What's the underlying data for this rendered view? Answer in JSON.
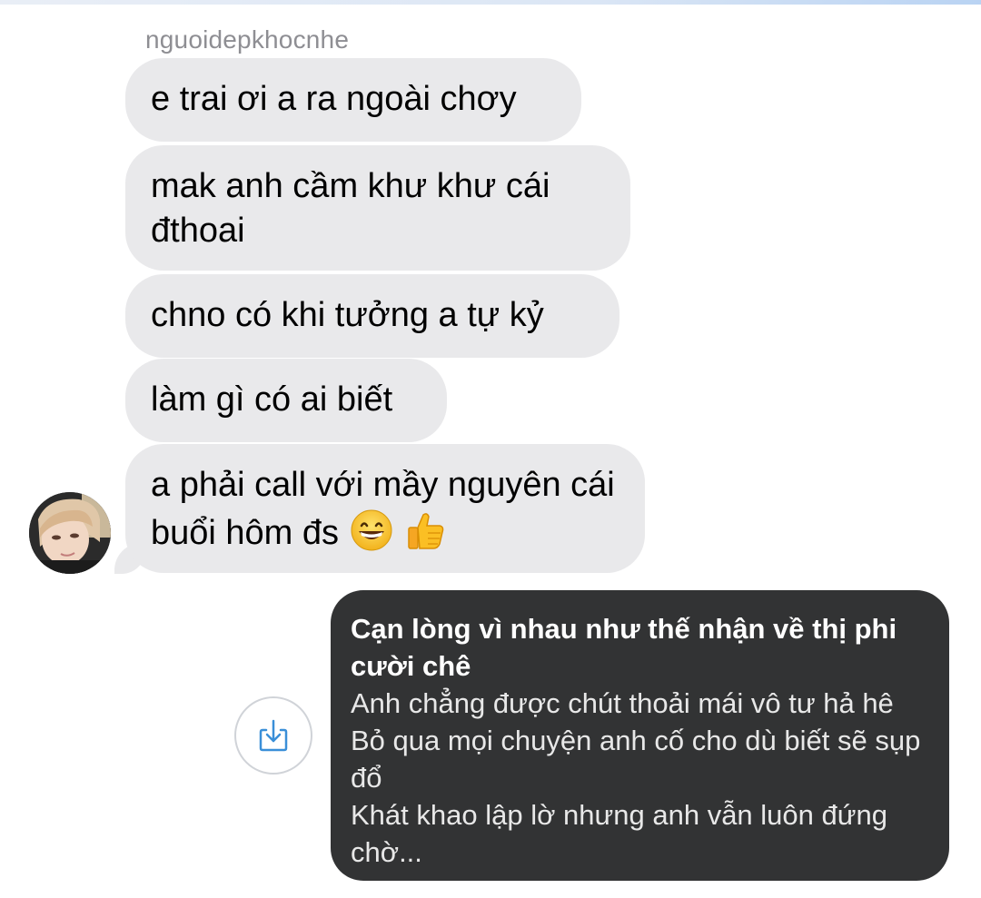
{
  "conversation": {
    "sender_name": "nguoidepkhocnhe",
    "messages": [
      {
        "text": "e trai ơi a ra ngoài chơy"
      },
      {
        "text": "mak anh cầm khư khư cái đthoai"
      },
      {
        "text": "chno có khi tưởng a tự kỷ"
      },
      {
        "text": "làm gì có ai biết"
      },
      {
        "text": "a phải call với mầy nguyên cái buổi hôm đs",
        "emojis": [
          "grinning-face-emoji",
          "thumbs-up-emoji"
        ]
      }
    ],
    "shared_card": {
      "title": "Cạn lòng vì nhau như thế nhận về thị phi cười chê",
      "lines": [
        "Anh chẳng được chút thoải mái vô tư hả hê",
        "Bỏ qua mọi chuyện anh cố cho dù biết sẽ sụp đổ",
        "Khát khao lập lờ nhưng anh vẫn luôn đứng chờ..."
      ]
    },
    "share_button_icon": "share-download-icon"
  },
  "colors": {
    "incoming_bubble": "#e9e9eb",
    "card_background": "#323334",
    "share_icon": "#3a8fd8",
    "sender_name": "#8e8e93"
  }
}
